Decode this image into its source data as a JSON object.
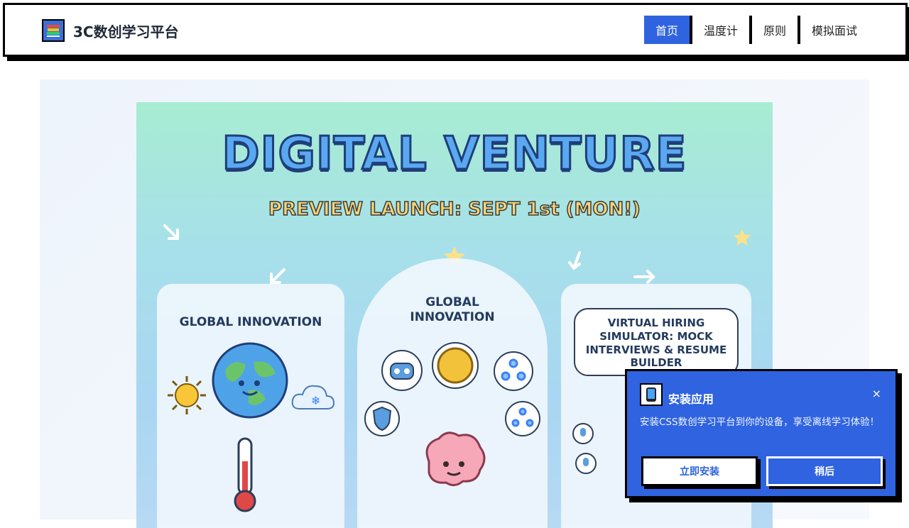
{
  "header": {
    "logo_icon": "books-icon",
    "title": "3C数创学习平台",
    "nav": [
      {
        "label": "首页",
        "active": true
      },
      {
        "label": "温度计",
        "active": false
      },
      {
        "label": "原则",
        "active": false
      },
      {
        "label": "模拟面试",
        "active": false
      }
    ]
  },
  "poster": {
    "title": "DIGITAL VENTURE",
    "subtitle": "PREVIEW LAUNCH: SEPT 1st (MON!)",
    "panels": [
      {
        "title": "GLOBAL INNOVATION"
      },
      {
        "title": "GLOBAL INNOVATION"
      },
      {
        "title": "VIRTUAL HIRING SIMULATOR: MOCK INTERVIEWS & RESUME BUILDER"
      }
    ]
  },
  "install_popup": {
    "icon": "phone-icon",
    "title": "安装应用",
    "close": "×",
    "message": "安装CSS数创学习平台到你的设备，享受离线学习体验！",
    "install_button": "立即安装",
    "later_button": "稍后"
  },
  "colors": {
    "accent": "#2f63e0",
    "border": "#000000"
  }
}
